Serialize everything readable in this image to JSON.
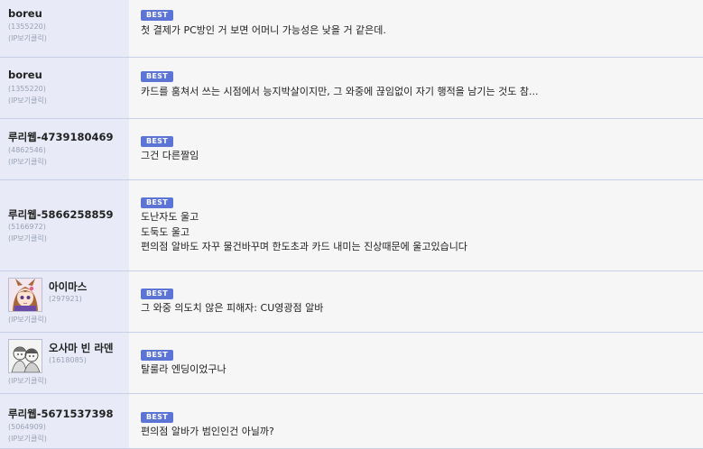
{
  "comments": [
    {
      "nick": "boreu",
      "uid": "(1355220)",
      "ip": "(IP보기클릭)",
      "best": "BEST",
      "lines": [
        "첫 결제가 PC방인 거 보면 어머니 가능성은 낮을 거 같은데."
      ]
    },
    {
      "nick": "boreu",
      "uid": "(1355220)",
      "ip": "(IP보기클릭)",
      "best": "BEST",
      "lines": [
        "카드를 훔쳐서 쓰는 시점에서 능지박살이지만, 그 와중에 끊임없이 자기 행적을 남기는 것도 참..."
      ]
    },
    {
      "nick": "루리웹-4739180469",
      "uid": "(4862546)",
      "ip": "(IP보기클릭)",
      "best": "BEST",
      "lines": [
        "그건 다른짤임"
      ]
    },
    {
      "nick": "루리웹-5866258859",
      "uid": "(5166972)",
      "ip": "(IP보기클릭)",
      "best": "BEST",
      "lines": [
        "도난자도 울고",
        "도둑도 울고",
        "편의점 알바도 자꾸 물건바꾸며 한도초과 카드 내미는 진상때문에 울고있습니다"
      ]
    },
    {
      "nick": "아이마스",
      "uid": "(297921)",
      "ip": "(IP보기클릭)",
      "best": "BEST",
      "lines": [
        "그 와중 의도치 않은 피해자: CU영광점 알바"
      ]
    },
    {
      "nick": "오사마 빈 라덴",
      "uid": "(1618085)",
      "ip": "(IP보기클릭)",
      "best": "BEST",
      "lines": [
        "탈룰라 엔딩이었구나"
      ]
    },
    {
      "nick": "루리웹-5671537398",
      "uid": "(5064909)",
      "ip": "(IP보기클릭)",
      "best": "BEST",
      "lines": [
        "편의점 알바가 범인인건 아닐까?"
      ]
    }
  ]
}
